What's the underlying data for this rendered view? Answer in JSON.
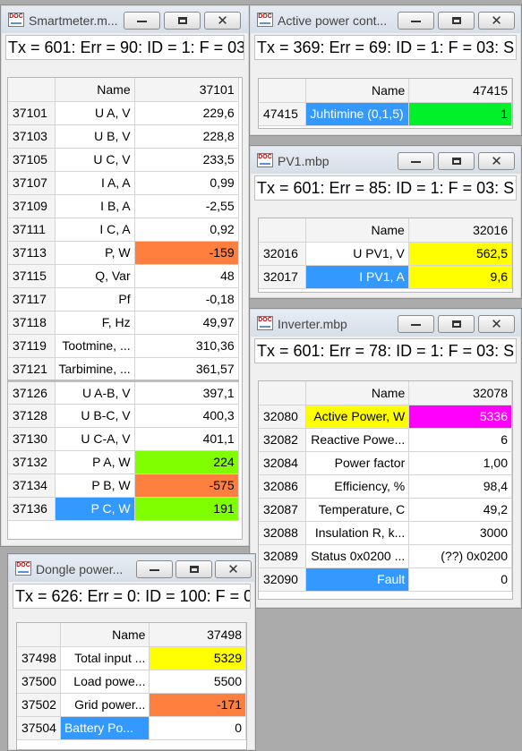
{
  "windows": {
    "smartmeter": {
      "title": "Smartmeter.m...",
      "status": "Tx = 601: Err = 90: ID = 1: F = 03:",
      "header": {
        "name": "Name",
        "value": "37101"
      },
      "rows": [
        {
          "addr": "37101",
          "name": "U A, V",
          "value": "229,6"
        },
        {
          "addr": "37103",
          "name": "U B, V",
          "value": "228,8"
        },
        {
          "addr": "37105",
          "name": "U C, V",
          "value": "233,5"
        },
        {
          "addr": "37107",
          "name": "I A, A",
          "value": "0,99"
        },
        {
          "addr": "37109",
          "name": "I B, A",
          "value": "-2,55"
        },
        {
          "addr": "37111",
          "name": "I C, A",
          "value": "0,92"
        },
        {
          "addr": "37113",
          "name": "P, W",
          "value": "-159"
        },
        {
          "addr": "37115",
          "name": "Q, Var",
          "value": "48"
        },
        {
          "addr": "37117",
          "name": "Pf",
          "value": "-0,18"
        },
        {
          "addr": "37118",
          "name": "F, Hz",
          "value": "49,97"
        },
        {
          "addr": "37119",
          "name": "Tootmine, ...",
          "value": "310,36"
        },
        {
          "addr": "37121",
          "name": "Tarbimine, ...",
          "value": "361,57"
        },
        {
          "addr": "37126",
          "name": "U A-B, V",
          "value": "397,1"
        },
        {
          "addr": "37128",
          "name": "U B-C, V",
          "value": "400,3"
        },
        {
          "addr": "37130",
          "name": "U C-A, V",
          "value": "401,1"
        },
        {
          "addr": "37132",
          "name": "P A, W",
          "value": "224"
        },
        {
          "addr": "37134",
          "name": "P B, W",
          "value": "-575"
        },
        {
          "addr": "37136",
          "name": "P C, W",
          "value": "191"
        }
      ]
    },
    "active_power": {
      "title": "Active power cont...",
      "status": "Tx = 369: Err = 69: ID = 1: F = 03: S",
      "header": {
        "name": "Name",
        "value": "47415"
      },
      "rows": [
        {
          "addr": "47415",
          "name": "Juhtimine (0,1,5)",
          "value": "1"
        }
      ]
    },
    "pv1": {
      "title": "PV1.mbp",
      "status": "Tx = 601: Err = 85: ID = 1: F = 03: S",
      "header": {
        "name": "Name",
        "value": "32016"
      },
      "rows": [
        {
          "addr": "32016",
          "name": "U PV1, V",
          "value": "562,5"
        },
        {
          "addr": "32017",
          "name": "I PV1, A",
          "value": "9,6"
        }
      ]
    },
    "inverter": {
      "title": "Inverter.mbp",
      "status": "Tx = 601: Err = 78: ID = 1: F = 03: S",
      "header": {
        "name": "Name",
        "value": "32078"
      },
      "rows": [
        {
          "addr": "32080",
          "name": "Active Power, W",
          "value": "5336"
        },
        {
          "addr": "32082",
          "name": "Reactive Powe...",
          "value": "6"
        },
        {
          "addr": "32084",
          "name": "Power factor",
          "value": "1,00"
        },
        {
          "addr": "32086",
          "name": "Efficiency, %",
          "value": "98,4"
        },
        {
          "addr": "32087",
          "name": "Temperature, C",
          "value": "49,2"
        },
        {
          "addr": "32088",
          "name": "Insulation R, k...",
          "value": "3000"
        },
        {
          "addr": "32089",
          "name": "Status 0x0200 ...",
          "value": "(??) 0x0200"
        },
        {
          "addr": "32090",
          "name": "Fault",
          "value": "0"
        }
      ]
    },
    "dongle": {
      "title": "Dongle power...",
      "status": "Tx = 626: Err = 0: ID = 100: F = 0",
      "header": {
        "name": "Name",
        "value": "37498"
      },
      "rows": [
        {
          "addr": "37498",
          "name": "Total input ...",
          "value": "5329"
        },
        {
          "addr": "37500",
          "name": "Load powe...",
          "value": "5500"
        },
        {
          "addr": "37502",
          "name": "Grid power...",
          "value": "-171"
        },
        {
          "addr": "37504",
          "name": "Battery Po...",
          "value": "0"
        }
      ]
    }
  },
  "icons": {
    "app_icon": "doc-icon",
    "minimize": "minimize-icon",
    "maximize": "maximize-icon",
    "close": "close-icon",
    "app_icon_text": "DOC",
    "close_glyph": "✕"
  },
  "colors": {
    "orange": "#ff7f3f",
    "green": "#7fff00",
    "bright_green": "#00f02c",
    "yellow": "#ffff00",
    "blue": "#3399ff",
    "magenta": "#ff00ff"
  }
}
